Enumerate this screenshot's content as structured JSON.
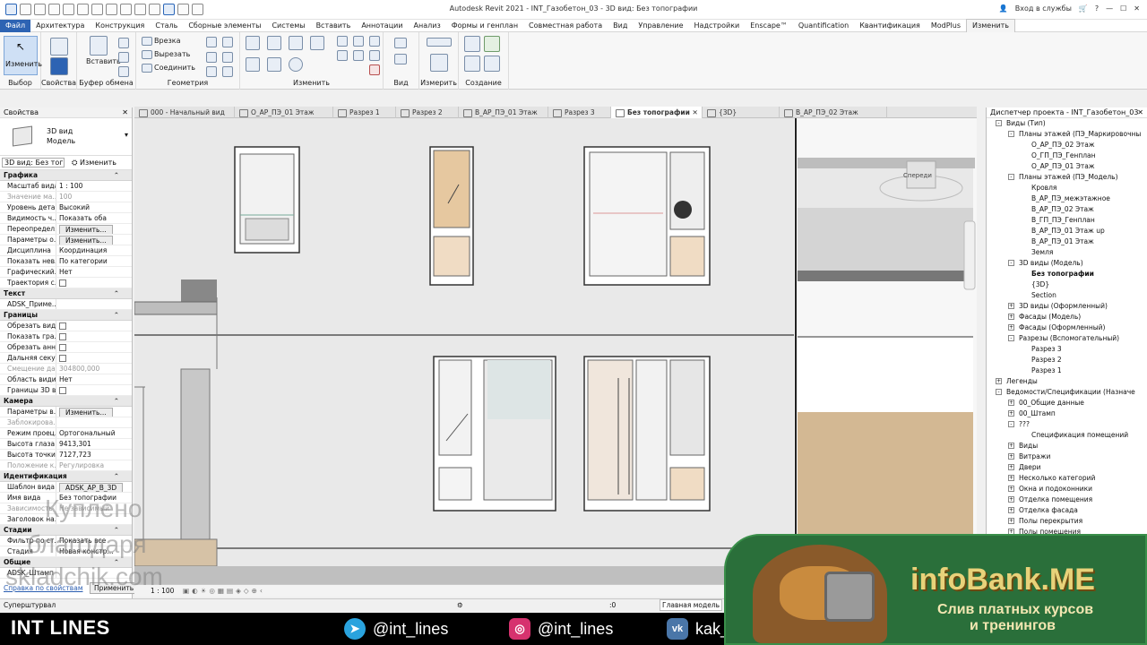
{
  "app": {
    "title": "Autodesk Revit 2021 - INT_Газобетон_03 - 3D вид: Без топографии",
    "signin": "Вход в службы",
    "help": "?"
  },
  "menu": [
    "Файл",
    "Архитектура",
    "Конструкция",
    "Сталь",
    "Сборные элементы",
    "Системы",
    "Вставить",
    "Аннотации",
    "Анализ",
    "Формы и генплан",
    "Совместная работа",
    "Вид",
    "Управление",
    "Надстройки",
    "Enscape™",
    "Quantification",
    "Квантификация",
    "ModPlus",
    "Изменить"
  ],
  "ribbon": {
    "select_big": "Изменить",
    "paste_big": "Вставить",
    "cut_label": "Врезка",
    "cut2_label": "Вырезать",
    "join_label": "Соединить",
    "groups": [
      "Выбор",
      "Свойства",
      "Буфер обмена",
      "Геометрия",
      "Изменить",
      "Вид",
      "Измерить",
      "Создание"
    ]
  },
  "properties": {
    "header": "Свойства",
    "type_line1": "3D вид",
    "type_line2": "Модель",
    "view_select": "3D вид: Без тог",
    "edit_type": "Изменить тип",
    "sections": [
      {
        "name": "Графика",
        "rows": [
          {
            "k": "Масштаб вида",
            "v": "1 : 100"
          },
          {
            "k": "Значение ма...",
            "v": "100",
            "dim": true
          },
          {
            "k": "Уровень дета...",
            "v": "Высокий"
          },
          {
            "k": "Видимость ч...",
            "v": "Показать оба"
          },
          {
            "k": "Переопредел...",
            "v": "Изменить...",
            "btn": true
          },
          {
            "k": "Параметры о...",
            "v": "Изменить...",
            "btn": true
          },
          {
            "k": "Дисциплина",
            "v": "Координация"
          },
          {
            "k": "Показать нев...",
            "v": "По категории"
          },
          {
            "k": "Графический...",
            "v": "Нет"
          },
          {
            "k": "Траектория с...",
            "v": "",
            "chk": true
          }
        ]
      },
      {
        "name": "Текст",
        "rows": [
          {
            "k": "ADSK_Приме...",
            "v": ""
          }
        ]
      },
      {
        "name": "Границы",
        "rows": [
          {
            "k": "Обрезать вид",
            "v": "",
            "chk": true
          },
          {
            "k": "Показать гра...",
            "v": "",
            "chk": true
          },
          {
            "k": "Обрезать анн...",
            "v": "",
            "chk": true
          },
          {
            "k": "Дальняя секу...",
            "v": "",
            "chk": true
          },
          {
            "k": "Смещение да...",
            "v": "304800,000",
            "dim": true
          },
          {
            "k": "Область види...",
            "v": "Нет"
          },
          {
            "k": "Границы 3D в...",
            "v": "",
            "chk": true
          }
        ]
      },
      {
        "name": "Камера",
        "rows": [
          {
            "k": "Параметры в...",
            "v": "Изменить...",
            "btn": true
          },
          {
            "k": "Заблокирова...",
            "v": "",
            "dim": true
          },
          {
            "k": "Режим проец...",
            "v": "Ортогональный"
          },
          {
            "k": "Высота глаза",
            "v": "9413,301"
          },
          {
            "k": "Высота точки...",
            "v": "7127,723"
          },
          {
            "k": "Положение к...",
            "v": "Регулировка",
            "dim": true
          }
        ]
      },
      {
        "name": "Идентификация",
        "rows": [
          {
            "k": "Шаблон вида",
            "v": "ADSK_АР_В_3D",
            "btn": true
          },
          {
            "k": "Имя вида",
            "v": "Без топографии"
          },
          {
            "k": "Зависимость",
            "v": "Не зависимый",
            "dim": true
          },
          {
            "k": "Заголовок на...",
            "v": ""
          }
        ]
      },
      {
        "name": "Стадии",
        "rows": [
          {
            "k": "Фильтр по ст...",
            "v": "Показать все"
          },
          {
            "k": "Стадия",
            "v": "Новая констр..."
          }
        ]
      },
      {
        "name": "Общие",
        "rows": [
          {
            "k": "ADSK_Штамп",
            "v": ""
          }
        ]
      }
    ],
    "help_link": "Справка по свойствам",
    "apply": "Применить"
  },
  "tabs": [
    {
      "label": "000 - Начальный вид",
      "active": false
    },
    {
      "label": "О_АР_ПЭ_01 Этаж",
      "active": false
    },
    {
      "label": "Разрез 1",
      "active": false
    },
    {
      "label": "Разрез 2",
      "active": false
    },
    {
      "label": "В_АР_ПЭ_01 Этаж",
      "active": false
    },
    {
      "label": "Разрез 3",
      "active": false
    },
    {
      "label": "Без топографии",
      "active": true
    },
    {
      "label": "{3D}",
      "active": false
    },
    {
      "label": "В_АР_ПЭ_02 Этаж",
      "active": false
    }
  ],
  "viewcube_label": "Спереди",
  "view_status": {
    "scale": "1 : 100"
  },
  "statusbar": {
    "left": "Суперштурвал",
    "model": "Главная модель",
    "zero": ":0"
  },
  "browser": {
    "header": "Диспетчер проекта - INT_Газобетон_03",
    "nodes": [
      {
        "l": "Виды (Тип)",
        "d": 0,
        "e": "-"
      },
      {
        "l": "Планы этажей (ПЭ_Маркировочны",
        "d": 1,
        "e": "-"
      },
      {
        "l": "О_АР_ПЭ_02 Этаж",
        "d": 2
      },
      {
        "l": "О_ГП_ПЭ_Генплан",
        "d": 2
      },
      {
        "l": "О_АР_ПЭ_01 Этаж",
        "d": 2
      },
      {
        "l": "Планы этажей (ПЭ_Модель)",
        "d": 1,
        "e": "-"
      },
      {
        "l": "Кровля",
        "d": 2
      },
      {
        "l": "В_АР_ПЭ_межэтажное",
        "d": 2
      },
      {
        "l": "В_АР_ПЭ_02 Этаж",
        "d": 2
      },
      {
        "l": "В_ГП_ПЭ_Генплан",
        "d": 2
      },
      {
        "l": "В_АР_ПЭ_01 Этаж up",
        "d": 2
      },
      {
        "l": "В_АР_ПЭ_01 Этаж",
        "d": 2
      },
      {
        "l": "Земля",
        "d": 2
      },
      {
        "l": "3D виды (Модель)",
        "d": 1,
        "e": "-"
      },
      {
        "l": "Без топографии",
        "d": 2,
        "b": true
      },
      {
        "l": "{3D}",
        "d": 2
      },
      {
        "l": "Section",
        "d": 2
      },
      {
        "l": "3D виды (Оформленный)",
        "d": 1,
        "e": "+"
      },
      {
        "l": "Фасады (Модель)",
        "d": 1,
        "e": "+"
      },
      {
        "l": "Фасады (Оформленный)",
        "d": 1,
        "e": "+"
      },
      {
        "l": "Разрезы (Вспомогательный)",
        "d": 1,
        "e": "-"
      },
      {
        "l": "Разрез 3",
        "d": 2
      },
      {
        "l": "Разрез 2",
        "d": 2
      },
      {
        "l": "Разрез 1",
        "d": 2
      },
      {
        "l": "Легенды",
        "d": 0,
        "e": "+"
      },
      {
        "l": "Ведомости/Спецификации (Назначе",
        "d": 0,
        "e": "-"
      },
      {
        "l": "00_Общие данные",
        "d": 1,
        "e": "+"
      },
      {
        "l": "00_Штамп",
        "d": 1,
        "e": "+"
      },
      {
        "l": "???",
        "d": 1,
        "e": "-"
      },
      {
        "l": "Спецификация помещений",
        "d": 2
      },
      {
        "l": "Виды",
        "d": 1,
        "e": "+"
      },
      {
        "l": "Витражи",
        "d": 1,
        "e": "+"
      },
      {
        "l": "Двери",
        "d": 1,
        "e": "+"
      },
      {
        "l": "Несколько категорий",
        "d": 1,
        "e": "+"
      },
      {
        "l": "Окна и подоконники",
        "d": 1,
        "e": "+"
      },
      {
        "l": "Отделка помещения",
        "d": 1,
        "e": "+"
      },
      {
        "l": "Отделка фасада",
        "d": 1,
        "e": "+"
      },
      {
        "l": "Полы перекрытия",
        "d": 1,
        "e": "+"
      },
      {
        "l": "Полы помещения",
        "d": 1,
        "e": "+"
      }
    ]
  },
  "footer": {
    "brand": "INT LINES",
    "telegram": "@int_lines",
    "instagram": "@int_lines",
    "vk": "kak_"
  },
  "promo": {
    "title": "infoBank.ME",
    "sub1": "Слив платных курсов",
    "sub2": "и тренингов"
  },
  "watermark": [
    "Куплено",
    "благодаря",
    "skladchik.com"
  ]
}
